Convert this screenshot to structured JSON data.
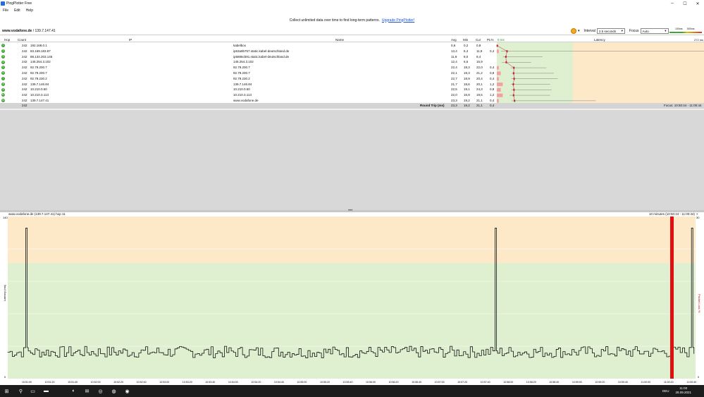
{
  "window": {
    "title": "PingPlotter Free",
    "controls": {
      "minimize": "─",
      "maximize": "☐",
      "close": "✕"
    }
  },
  "menu": [
    "File",
    "Edit",
    "Help"
  ],
  "banner": {
    "text": "Collect unlimited data over time to find long-term patterns.",
    "link": "Upgrade PingPlotter!"
  },
  "target": {
    "host": "www.vodafone.de",
    "ip": " / 139.7.147.41",
    "interval_label": "Interval",
    "interval_value": "2.5 seconds",
    "focus_label": "Focus",
    "focus_value": "Auto",
    "scale": {
      "a": "100ms",
      "b": "500ms",
      "max_label": "272 ms"
    }
  },
  "table": {
    "headers": {
      "hop": "Hop",
      "count": "Count",
      "ip": "IP",
      "name": "Name",
      "avg": "Avg",
      "min": "Min",
      "cur": "Cur",
      "pl": "PL%",
      "zero": "0 ms",
      "latency": "Latency"
    },
    "rows": [
      {
        "hop": "1",
        "count": "242",
        "ip": "192.168.0.1",
        "name": "kabelbox",
        "avg": "0,6",
        "min": "0,2",
        "cur": "0,8",
        "pl": "",
        "avg_ms": 0.6,
        "min_ms": 0.2,
        "max_ms": 2,
        "pl_pct": 0
      },
      {
        "hop": "2",
        "count": "242",
        "ip": "83.169.183.87",
        "name": "ip53a9b757.static.kabel-deutschland.de",
        "avg": "13,4",
        "min": "5,4",
        "cur": "11,8",
        "pl": "0,4",
        "avg_ms": 13.4,
        "min_ms": 5.4,
        "max_ms": 272,
        "pl_pct": 0.4
      },
      {
        "hop": "3",
        "count": "242",
        "ip": "88.134.203.145",
        "name": "ip5886cb91.static.kabel-deutschland.de",
        "avg": "11,9",
        "min": "8,0",
        "cur": "9,4",
        "pl": "",
        "avg_ms": 11.9,
        "min_ms": 8.0,
        "max_ms": 60,
        "pl_pct": 0
      },
      {
        "hop": "4",
        "count": "242",
        "ip": "145.254.3.102",
        "name": "145.254.3.102",
        "avg": "12,4",
        "min": "6,5",
        "cur": "15,9",
        "pl": "",
        "avg_ms": 12.4,
        "min_ms": 6.5,
        "max_ms": 45,
        "pl_pct": 0
      },
      {
        "hop": "5",
        "count": "242",
        "ip": "92.79.200.7",
        "name": "92.79.200.7",
        "avg": "22,4",
        "min": "18,3",
        "cur": "22,0",
        "pl": "0,4",
        "avg_ms": 22.4,
        "min_ms": 18.3,
        "max_ms": 65,
        "pl_pct": 0.4
      },
      {
        "hop": "6",
        "count": "242",
        "ip": "92.79.200.7",
        "name": "92.79.200.7",
        "avg": "22,1",
        "min": "19,3",
        "cur": "21,2",
        "pl": "0,8",
        "avg_ms": 22.1,
        "min_ms": 19.3,
        "max_ms": 75,
        "pl_pct": 0.8
      },
      {
        "hop": "7",
        "count": "242",
        "ip": "92.79.230.2",
        "name": "92.79.230.2",
        "avg": "22,7",
        "min": "18,9",
        "cur": "20,4",
        "pl": "0,4",
        "avg_ms": 22.7,
        "min_ms": 18.9,
        "max_ms": 80,
        "pl_pct": 0.4
      },
      {
        "hop": "8",
        "count": "242",
        "ip": "139.7.146.84",
        "name": "139.7.146.84",
        "avg": "21,7",
        "min": "18,6",
        "cur": "20,1",
        "pl": "1,2",
        "avg_ms": 21.7,
        "min_ms": 18.6,
        "max_ms": 70,
        "pl_pct": 1.2
      },
      {
        "hop": "9",
        "count": "242",
        "ip": "10.210.0.50",
        "name": "10.210.0.50",
        "avg": "22,5",
        "min": "19,1",
        "cur": "24,3",
        "pl": "0,8",
        "avg_ms": 22.5,
        "min_ms": 19.1,
        "max_ms": 72,
        "pl_pct": 0.8
      },
      {
        "hop": "10",
        "count": "242",
        "ip": "10.210.3.113",
        "name": "10.210.3.113",
        "avg": "22,0",
        "min": "16,8",
        "cur": "19,5",
        "pl": "1,2",
        "avg_ms": 22.0,
        "min_ms": 16.8,
        "max_ms": 70,
        "pl_pct": 1.2
      },
      {
        "hop": "11",
        "count": "242",
        "ip": "139.7.147.41",
        "name": "www.vodafone.de",
        "avg": "23,3",
        "min": "19,2",
        "cur": "21,1",
        "pl": "0,4",
        "avg_ms": 23.3,
        "min_ms": 19.2,
        "max_ms": 130,
        "pl_pct": 0.4
      }
    ],
    "rtt": {
      "count": "242",
      "label": "Round Trip (ms)",
      "avg": "23,3",
      "min": "19,2",
      "cur": "21,1",
      "pl": "0,4",
      "focus": "Focus: 10:50:44 - 11:00:44"
    }
  },
  "graph": {
    "title": "www.vodafone.de (139.7.147.41) hop 11",
    "range": "10 minutes (10:50:44 - 11:00:44)",
    "y_left_label": "Latency (ms)",
    "y_right_label": "Packet Loss %",
    "y_max_label": "140",
    "y_min_label": "0",
    "pl_max_label": "30",
    "pl_min_label": "0",
    "x_ticks": [
      "10:51:00",
      "10:51:20",
      "10:51:40",
      "10:52:00",
      "10:52:20",
      "10:52:40",
      "10:53:00",
      "10:53:20",
      "10:53:40",
      "10:54:00",
      "10:54:20",
      "10:54:40",
      "10:55:00",
      "10:55:20",
      "10:55:40",
      "10:56:00",
      "10:56:20",
      "10:56:40",
      "10:57:00",
      "10:57:20",
      "10:57:40",
      "10:58:00",
      "10:58:20",
      "10:58:40",
      "10:59:00",
      "10:59:20",
      "10:59:40",
      "11:00:00",
      "11:00:20",
      "11:00:40"
    ],
    "colors": {
      "yellow": "#fde9c8",
      "green": "#dff0d0",
      "line": "#111111",
      "loss": "#e01010"
    }
  },
  "chart_data": {
    "type": "line",
    "x_range": [
      "10:50:44",
      "11:00:44"
    ],
    "ylim": [
      0,
      140
    ],
    "spikes_ms": [
      {
        "time": "10:51:00",
        "value": 130
      },
      {
        "time": "10:57:50",
        "value": 130
      },
      {
        "time": "11:00:40",
        "value": 130
      }
    ],
    "baseline_ms": 23,
    "packet_loss_event_time": "11:00:12"
  },
  "taskbar": {
    "icons": [
      "⊞",
      "⚲",
      "▭",
      "▬",
      "◐",
      "✉",
      "◎",
      "◍",
      "◉",
      "✦"
    ],
    "time": "11:00",
    "date": "28.09.2021",
    "lang": "DEU"
  }
}
